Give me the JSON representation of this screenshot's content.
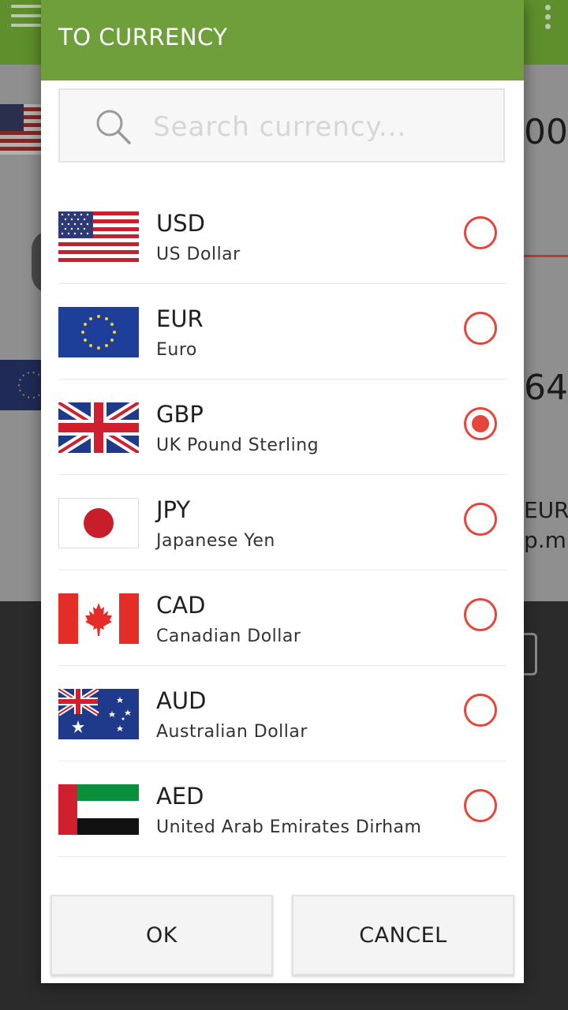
{
  "background": {
    "amount_top": "00",
    "amount_mid": "64",
    "label_code": "EUR",
    "label_time": "p.m."
  },
  "dialog": {
    "title": "TO CURRENCY",
    "search": {
      "placeholder": "Search currency..."
    },
    "currencies": [
      {
        "code": "USD",
        "name": "US Dollar",
        "flag": "us-flag-icon",
        "selected": false
      },
      {
        "code": "EUR",
        "name": "Euro",
        "flag": "eu-flag-icon",
        "selected": false
      },
      {
        "code": "GBP",
        "name": "UK Pound Sterling",
        "flag": "uk-flag-icon",
        "selected": true
      },
      {
        "code": "JPY",
        "name": "Japanese Yen",
        "flag": "japan-flag-icon",
        "selected": false
      },
      {
        "code": "CAD",
        "name": "Canadian Dollar",
        "flag": "canada-flag-icon",
        "selected": false
      },
      {
        "code": "AUD",
        "name": "Australian Dollar",
        "flag": "australia-flag-icon",
        "selected": false
      },
      {
        "code": "AED",
        "name": "United Arab Emirates Dirham",
        "flag": "uae-flag-icon",
        "selected": false
      }
    ],
    "ok_label": "OK",
    "cancel_label": "CANCEL"
  },
  "colors": {
    "header": "#6e9f3a",
    "radio_accent": "#e6463a"
  }
}
